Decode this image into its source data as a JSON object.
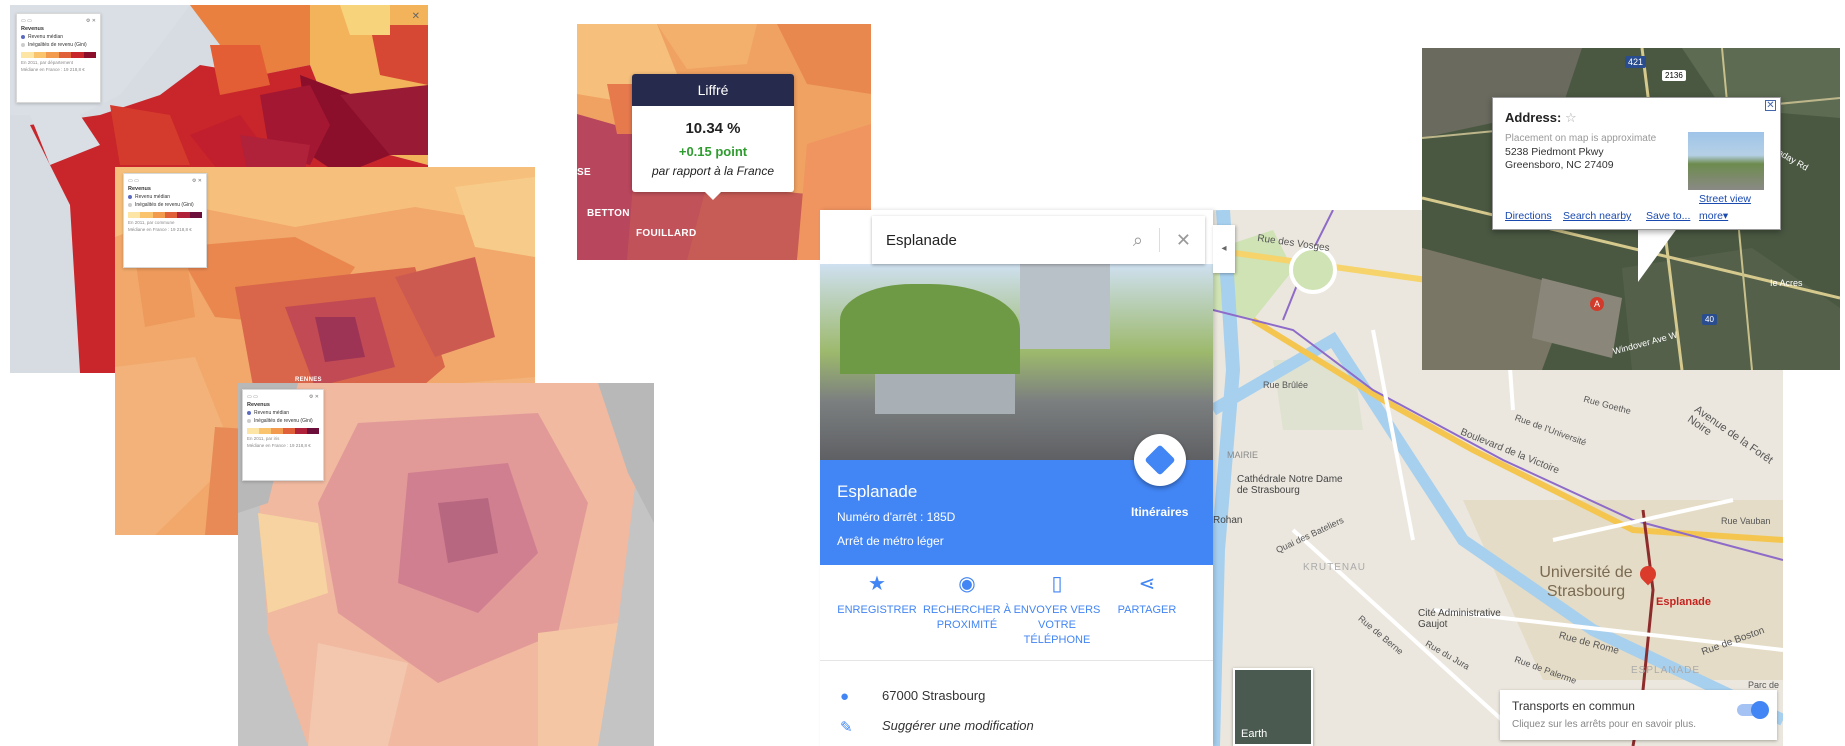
{
  "choropleth_maps": {
    "panel1": {
      "title": "Revenus",
      "item1": "Revenu médian",
      "item2": "Inégalités de revenu (Gini)",
      "level_text": "En 2011, par département",
      "france_text": "Médiane en France : 19 218,8 €"
    },
    "panel2": {
      "title": "Revenus",
      "item1": "Revenu médian",
      "item2": "Inégalités de revenu (Gini)",
      "level_text": "En 2011, par commune",
      "france_text": "Médiane en France : 19 218,8 €"
    },
    "panel3": {
      "title": "Revenus",
      "item1": "Revenu médian",
      "item2": "Inégalités de revenu (Gini)",
      "level_text": "En 2011, par iris",
      "france_text": "Médiane en France : 19 218,8 €"
    },
    "labels": {
      "rennes": "RENNES",
      "betton": "BETTON",
      "fouillard": "FOUILLARD",
      "se": "SE"
    }
  },
  "tooltip": {
    "title": "Liffré",
    "value": "10.34 %",
    "delta": "+0.15 point",
    "note": "par rapport à la France"
  },
  "google_maps": {
    "search_value": "Esplanade",
    "place_name": "Esplanade",
    "stop_number": "Numéro d'arrêt : 185D",
    "stop_type": "Arrêt de métro léger",
    "directions_label": "Itinéraires",
    "actions": [
      {
        "icon": "★",
        "label": "ENREGISTRER"
      },
      {
        "icon": "◉",
        "label": "RECHERCHER À PROXIMITÉ"
      },
      {
        "icon": "▯",
        "label": "ENVOYER VERS VOTRE TÉLÉPHONE"
      },
      {
        "icon": "⋖",
        "label": "PARTAGER"
      }
    ],
    "address": "67000 Strasbourg",
    "suggest": "Suggérer une modification",
    "map_labels": {
      "vosges": "Rue des Vosges",
      "foret_noire": "Avenue de la Forêt Noire",
      "universite": "Université de Strasbourg",
      "esplanade_pin": "Esplanade",
      "cathedrale": "Cathédrale Notre Dame de Strasbourg",
      "cite_admin": "Cité Administrative Gaujot",
      "rue_rome": "Rue de Rome",
      "rue_boston": "Rue de Boston",
      "krutenau": "KRUTENAU",
      "bd_victoire": "Boulevard de la Victoire",
      "quai_bateliers": "Quai des Bateliers",
      "rue_brulee": "Rue Brûlée",
      "rue_rohan": "Rohan",
      "rue_universite": "Rue de l'Université",
      "rue_goethe": "Rue Goethe",
      "rue_vauban": "Rue Vauban",
      "rue_jura": "Rue du Jura",
      "rue_berne": "Rue de Berne",
      "rue_palerme": "Rue de Palerme",
      "parc": "Parc de l'Ét",
      "esplanade_area": "ESPLANADE",
      "mairie": "MAIRIE"
    },
    "earth_label": "Earth",
    "transit_title": "Transports en commun",
    "transit_hint": "Cliquez sur les arrêts pour en savoir plus."
  },
  "address_popup": {
    "heading": "Address:",
    "note": "Placement on map is approximate",
    "line1": "5238 Piedmont Pkwy",
    "line2": "Greensboro, NC 27409",
    "street_view": "Street view",
    "directions": "Directions",
    "search_nearby": "Search nearby",
    "save_to": "Save to...",
    "more": "more▾",
    "marker": "A",
    "road_labels": {
      "windover": "Windover Ave W",
      "ie_acres": "Ie Acres",
      "hornaday": "Hornaday Rd",
      "shield_421": "421",
      "shield_2136": "2136",
      "shield_40": "40"
    }
  }
}
